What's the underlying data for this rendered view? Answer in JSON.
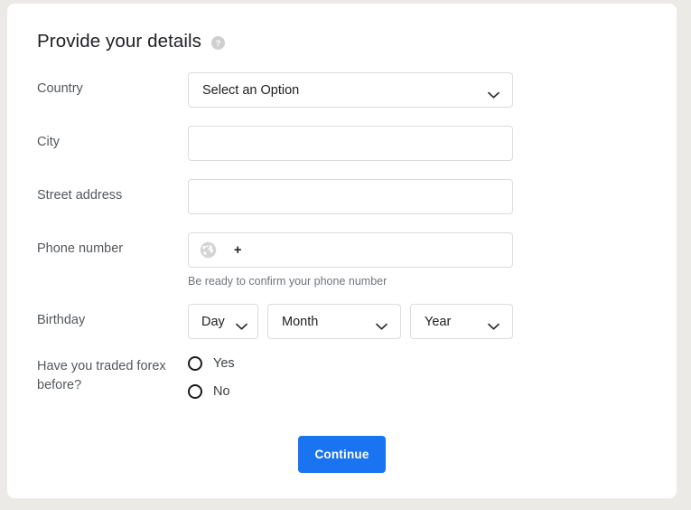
{
  "card": {
    "title": "Provide your details",
    "help_icon": "help-circle-icon"
  },
  "form": {
    "country": {
      "label": "Country",
      "selected": "Select an Option",
      "chevron_icon": "chevron-down-icon"
    },
    "city": {
      "label": "City",
      "value": "",
      "placeholder": ""
    },
    "street": {
      "label": "Street address",
      "value": "",
      "placeholder": ""
    },
    "phone": {
      "label": "Phone number",
      "globe_icon": "globe-icon",
      "prefix": "+",
      "value": "",
      "placeholder": "",
      "hint": "Be ready to confirm your phone number"
    },
    "birthday": {
      "label": "Birthday",
      "day": "Day",
      "month": "Month",
      "year": "Year",
      "chevron_icon": "chevron-down-icon"
    },
    "forex": {
      "label": "Have you traded forex before?",
      "options": [
        {
          "label": "Yes",
          "selected": false
        },
        {
          "label": "No",
          "selected": false
        }
      ]
    }
  },
  "actions": {
    "submit_label": "Continue"
  },
  "colors": {
    "accent": "#1a73f0",
    "page_background": "#eceae6",
    "card_background": "#ffffff",
    "border": "#dadce0",
    "label_text": "#54585c",
    "hint_text": "#70757a"
  }
}
